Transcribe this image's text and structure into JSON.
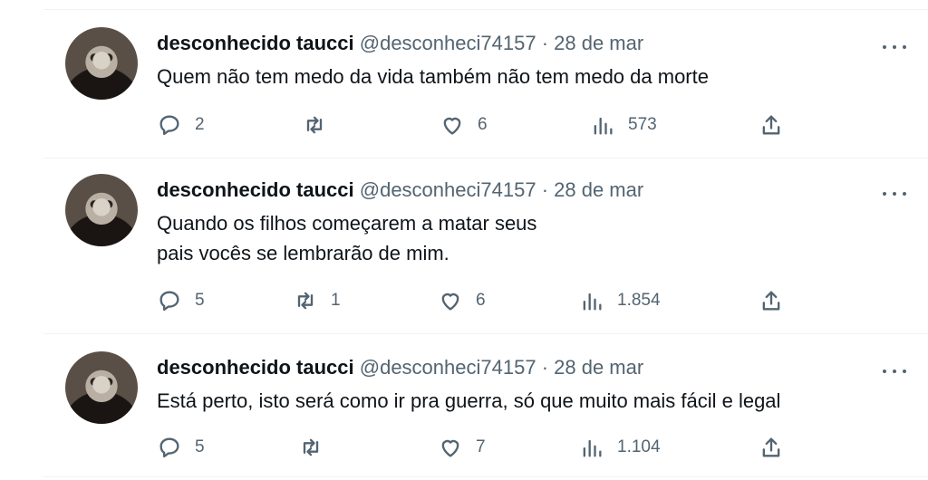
{
  "tweets": [
    {
      "name": "desconhecido taucci",
      "handle": "@desconheci74157",
      "separator": "·",
      "date": "28 de mar",
      "lines": [
        "Quem não tem medo da vida também não tem medo da morte"
      ],
      "replies": "2",
      "retweets": "",
      "likes": "6",
      "views": "573"
    },
    {
      "name": "desconhecido taucci",
      "handle": "@desconheci74157",
      "separator": "·",
      "date": "28 de mar",
      "lines": [
        "Quando os filhos começarem a matar seus",
        "pais vocês se lembrarão de mim."
      ],
      "replies": "5",
      "retweets": "1",
      "likes": "6",
      "views": "1.854"
    },
    {
      "name": "desconhecido taucci",
      "handle": "@desconheci74157",
      "separator": "·",
      "date": "28 de mar",
      "lines": [
        "Está perto, isto será como ir pra guerra, só que muito mais fácil e legal"
      ],
      "replies": "5",
      "retweets": "",
      "likes": "7",
      "views": "1.104"
    }
  ],
  "icons": {
    "reply": "speech-bubble-icon",
    "retweet": "retweet-arrows-icon",
    "like": "heart-icon",
    "views": "bar-chart-icon",
    "share": "share-upload-icon",
    "more": "ellipsis-icon"
  },
  "colors": {
    "text": "#0f1419",
    "secondary": "#536471",
    "divider": "#eff3f4"
  }
}
